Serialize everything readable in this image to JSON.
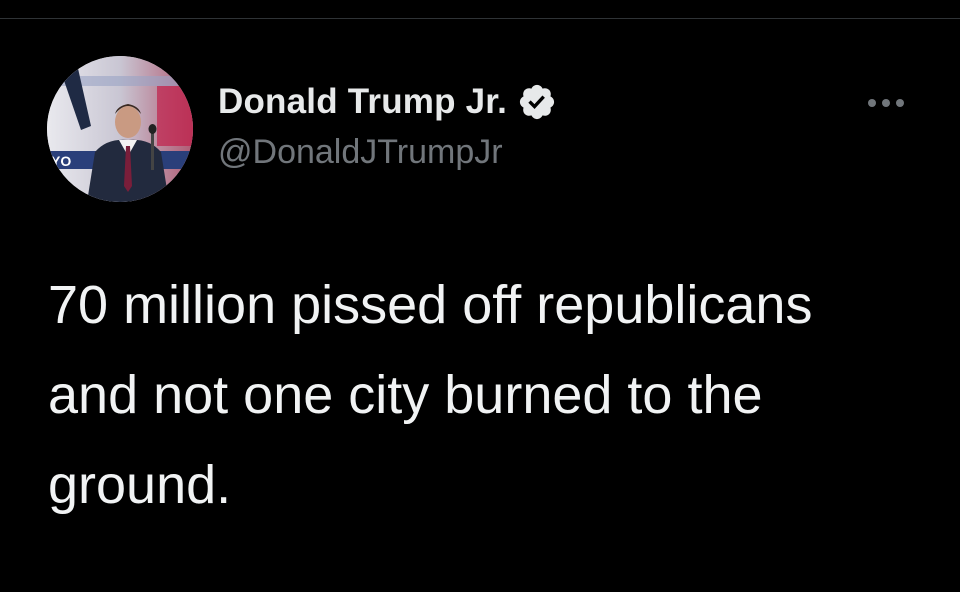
{
  "tweet": {
    "author": {
      "display_name": "Donald Trump Jr.",
      "handle": "@DonaldJTrumpJr",
      "verified": true,
      "verified_icon": "verified-badge-icon",
      "avatar": "profile-photo"
    },
    "more_icon": "more-options-icon",
    "text": "70 million pissed off republicans\nand not one city burned to the\nground."
  },
  "colors": {
    "background": "#000000",
    "primary_text": "#e7e9ea",
    "secondary_text": "#71767b"
  }
}
